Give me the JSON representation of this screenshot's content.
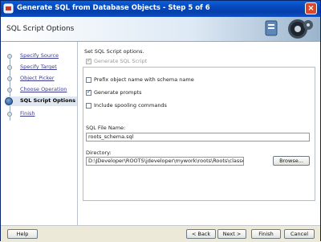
{
  "window": {
    "title": "Generate SQL from Database Objects - Step 5 of 6",
    "close_glyph": "×"
  },
  "banner": {
    "heading": "SQL Script Options"
  },
  "steps": [
    {
      "label": "Specify Source",
      "state": "done"
    },
    {
      "label": "Specify Target",
      "state": "done"
    },
    {
      "label": "Object Picker",
      "state": "done"
    },
    {
      "label": "Choose Operation",
      "state": "done"
    },
    {
      "label": "SQL Script Options",
      "state": "active"
    },
    {
      "label": "Finish",
      "state": "pending"
    }
  ],
  "content": {
    "description": "Set SQL Script options.",
    "generate_sql_script": {
      "label": "Generate SQL Script",
      "checked": true,
      "enabled": false
    },
    "prefix_object_name": {
      "label": "Prefix object name with schema name",
      "checked": false
    },
    "generate_prompts": {
      "label": "Generate prompts",
      "checked": true
    },
    "include_spooling": {
      "label": "Include spooling commands",
      "checked": false
    },
    "sql_file_name": {
      "label": "SQL File Name:",
      "value": "roots_schema.sql"
    },
    "directory": {
      "label": "Directory:",
      "value": "D:\\JDeveloper\\ROOTS\\jdeveloper\\mywork\\roots\\Roots\\classes"
    },
    "browse_label": "Browse..."
  },
  "footer": {
    "help_label": "Help",
    "back_label": "< Back",
    "next_label": "Next >",
    "finish_label": "Finish",
    "cancel_label": "Cancel"
  }
}
